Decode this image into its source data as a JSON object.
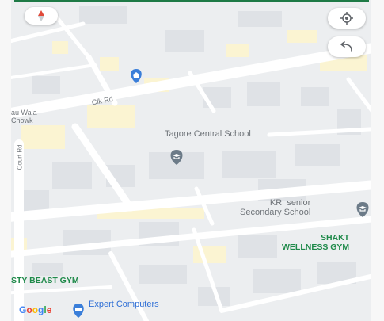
{
  "map": {
    "labels": {
      "road_primary": "Clk Rd",
      "chowk": "au Wala\nChowk",
      "court_rd": "Court Rd",
      "school_central": "Tagore Central School",
      "school_kr": "KR  senior\nSecondary School",
      "gym_shakti": "SHAKT\nWELLNESS GYM",
      "gym_beast": "STY BEAST GYM",
      "computers": "Expert Computers"
    },
    "logo": {
      "letters": [
        "G",
        "o",
        "o",
        "g",
        "l",
        "e"
      ]
    },
    "controls": {
      "compass_icon": "compass-icon",
      "location_icon": "my-location-icon",
      "back_icon": "undo-icon"
    },
    "colors": {
      "background": "#eceef0",
      "road": "#ffffff",
      "park": "#fbf4d2",
      "pin_gray": "#6c7b88",
      "pin_blue": "#3a7ed9",
      "label_green": "#1f8a4a",
      "label_blue": "#2f6fd6",
      "compass_red": "#e04a3a",
      "top_bar": "#1e7a46",
      "logo": [
        "#4285f4",
        "#ea4335",
        "#fbbc05",
        "#4285f4",
        "#34a853",
        "#ea4335"
      ]
    }
  }
}
